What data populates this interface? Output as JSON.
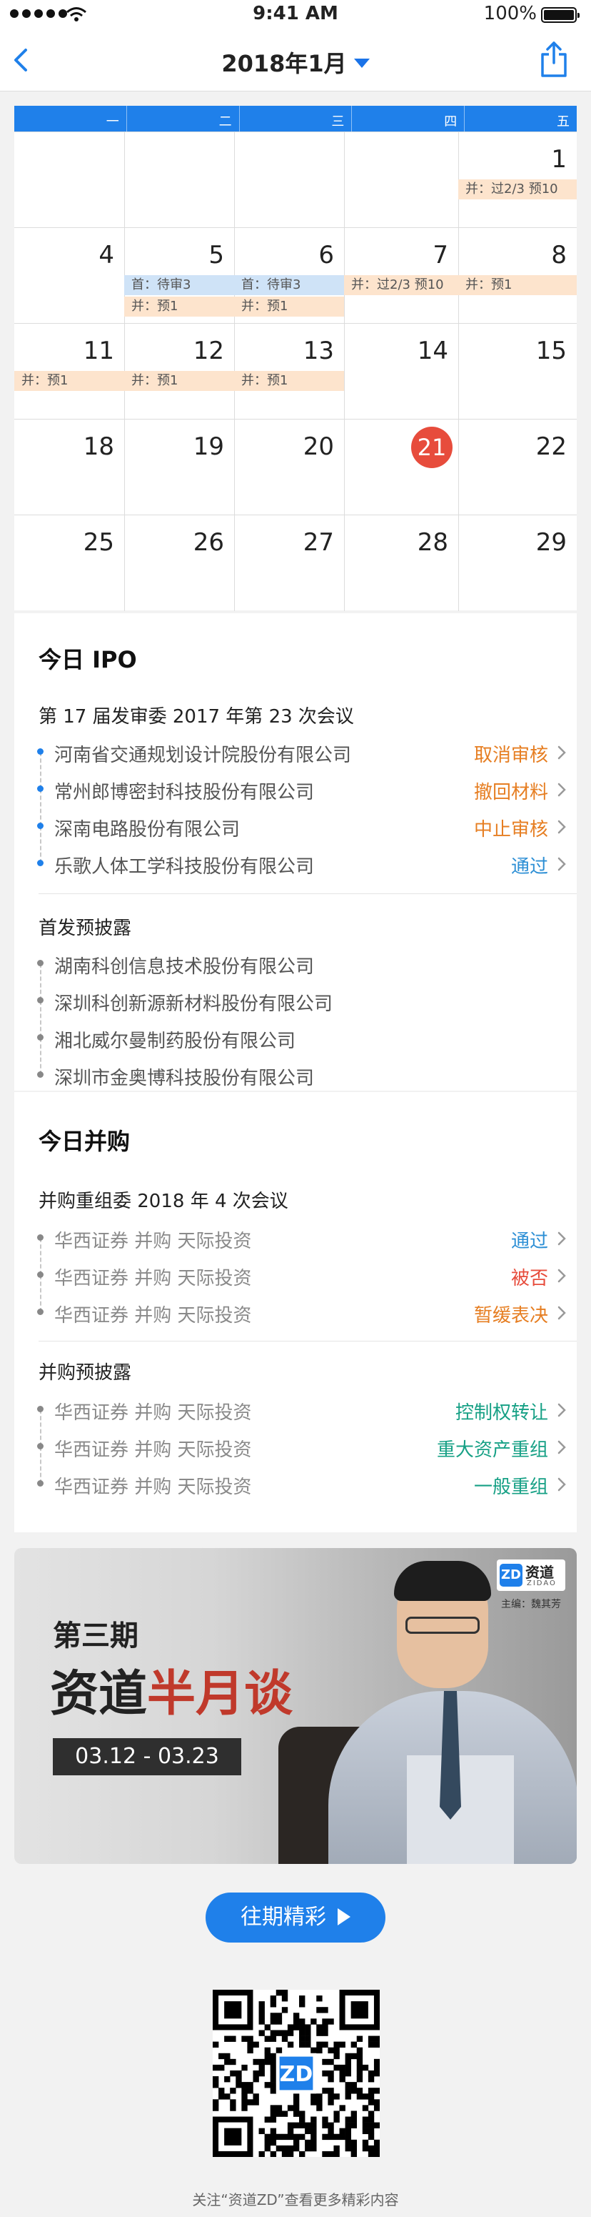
{
  "status_bar": {
    "time": "9:41 AM",
    "battery": "100%"
  },
  "nav": {
    "title": "2018年1月"
  },
  "calendar": {
    "weekdays": [
      "一",
      "二",
      "三",
      "四",
      "五"
    ],
    "rows": [
      {
        "days": [
          "",
          "",
          "",
          "",
          "1"
        ],
        "events": [
          {
            "col": 4,
            "slot": 0,
            "text": "并：过2/3 预10",
            "color": "peach"
          }
        ]
      },
      {
        "days": [
          "4",
          "5",
          "6",
          "7",
          "8"
        ],
        "events": [
          {
            "col": 1,
            "slot": 0,
            "text": "首：待审3",
            "color": "blue"
          },
          {
            "col": 2,
            "slot": 0,
            "text": "首：待审3",
            "color": "blue"
          },
          {
            "col": 1,
            "slot": 1,
            "text": "并：预1",
            "color": "peach"
          },
          {
            "col": 2,
            "slot": 1,
            "text": "并：预1",
            "color": "peach"
          },
          {
            "col": 3,
            "slot": 0,
            "text": "并：过2/3 预10",
            "color": "peach"
          },
          {
            "col": 4,
            "slot": 0,
            "text": "并：预1",
            "color": "peach"
          }
        ]
      },
      {
        "days": [
          "11",
          "12",
          "13",
          "14",
          "15"
        ],
        "events": [
          {
            "col": 0,
            "slot": 0,
            "text": "并：预1",
            "color": "peach"
          },
          {
            "col": 1,
            "slot": 0,
            "text": "并：预1",
            "color": "peach"
          },
          {
            "col": 2,
            "slot": 0,
            "text": "并：预1",
            "color": "peach"
          }
        ]
      },
      {
        "days": [
          "18",
          "19",
          "20",
          "21",
          "22"
        ],
        "today": "21",
        "events": []
      },
      {
        "days": [
          "25",
          "26",
          "27",
          "28",
          "29"
        ],
        "events": []
      }
    ]
  },
  "ipo": {
    "title": "今日 IPO",
    "meeting_title": "第 17 届发审委 2017 年第 23 次会议",
    "meeting_items": [
      {
        "name": "河南省交通规划设计院股份有限公司",
        "status": "取消审核",
        "status_color": "#e67e22"
      },
      {
        "name": "常州郎博密封科技股份有限公司",
        "status": "撤回材料",
        "status_color": "#e67e22"
      },
      {
        "name": "深南电路股份有限公司",
        "status": "中止审核",
        "status_color": "#e67e22"
      },
      {
        "name": "乐歌人体工学科技股份有限公司",
        "status": "通过",
        "status_color": "#2d8fd5"
      }
    ],
    "disclosure_title": "首发预披露",
    "disclosure_items": [
      "湖南科创信息技术股份有限公司",
      "深圳科创新源新材料股份有限公司",
      "湘北威尔曼制药股份有限公司",
      "深圳市金奥博科技股份有限公司"
    ]
  },
  "ma": {
    "title": "今日并购",
    "meeting_title": "并购重组委 2018 年 4 次会议",
    "meeting_items": [
      {
        "name": "华西证券 并购 天际投资",
        "status": "通过",
        "status_color": "#2d8fd5"
      },
      {
        "name": "华西证券 并购 天际投资",
        "status": "被否",
        "status_color": "#e74c3c"
      },
      {
        "name": "华西证券 并购 天际投资",
        "status": "暂缓表决",
        "status_color": "#e67e22"
      }
    ],
    "disclosure_title": "并购预披露",
    "disclosure_items": [
      {
        "name": "华西证券 并购 天际投资",
        "status": "控制权转让",
        "status_color": "#16a085"
      },
      {
        "name": "华西证券 并购 天际投资",
        "status": "重大资产重组",
        "status_color": "#16a085"
      },
      {
        "name": "华西证券 并购 天际投资",
        "status": "一般重组",
        "status_color": "#16a085"
      }
    ]
  },
  "banner": {
    "issue": "第三期",
    "headline_a": "资道",
    "headline_b": "半月谈",
    "dates": "03.12 - 03.23",
    "logo_cn": "资道",
    "logo_en": "ZIDAO",
    "host": "主编：魏其芳"
  },
  "past_button": "往期精彩",
  "footer": "关注“资道ZD”查看更多精彩内容"
}
